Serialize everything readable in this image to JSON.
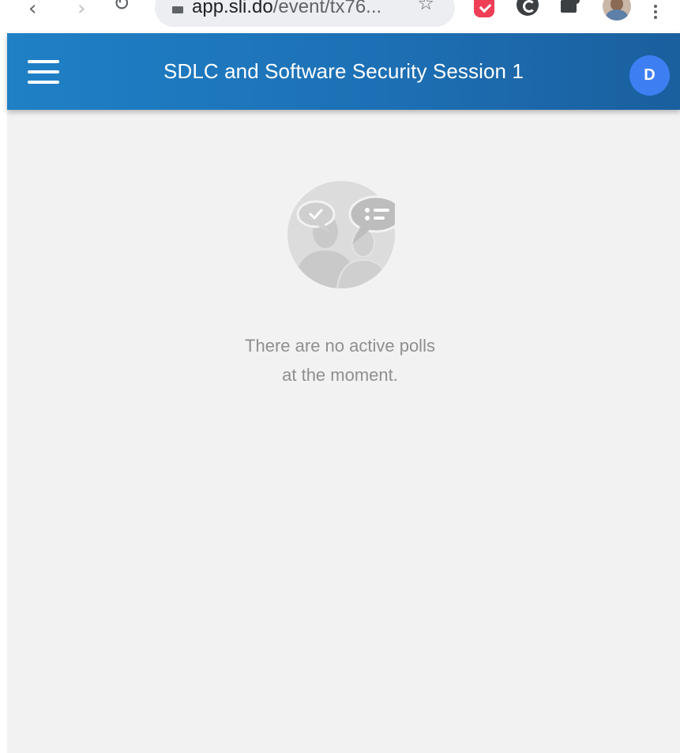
{
  "browser": {
    "url_main": "app.sli.do",
    "url_rest": "/event/tx76..."
  },
  "header": {
    "title": "SDLC and Software Security Session 1",
    "avatar_initial": "D"
  },
  "empty_state": {
    "line1": "There are no active polls",
    "line2": "at the moment."
  },
  "colors": {
    "app_bar": "#1d70b5",
    "avatar": "#3d7ff2",
    "background": "#f2f2f2",
    "message_text": "#8f8f8f"
  }
}
